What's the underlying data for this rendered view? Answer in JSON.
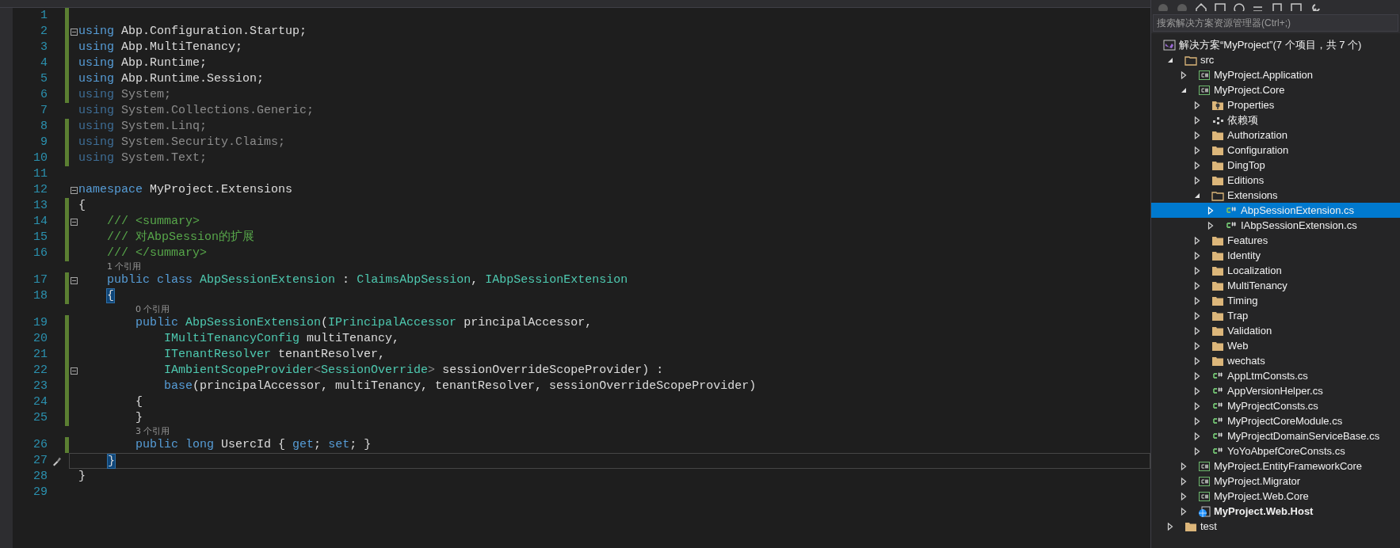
{
  "editor": {
    "lines": [
      {
        "number": "1",
        "modified": true,
        "fold": false,
        "current": false
      },
      {
        "number": "2",
        "modified": true,
        "fold": true,
        "current": false,
        "tokens": [
          {
            "kind": "kw",
            "text": "using"
          },
          {
            "kind": "text",
            "text": " Abp.Configuration.Startup;"
          }
        ]
      },
      {
        "number": "3",
        "modified": true,
        "fold": false,
        "current": false,
        "tokens": [
          {
            "kind": "kw",
            "text": "using"
          },
          {
            "kind": "text",
            "text": " Abp.MultiTenancy;"
          }
        ]
      },
      {
        "number": "4",
        "modified": true,
        "fold": false,
        "current": false,
        "tokens": [
          {
            "kind": "kw",
            "text": "using"
          },
          {
            "kind": "text",
            "text": " Abp.Runtime;"
          }
        ]
      },
      {
        "number": "5",
        "modified": true,
        "fold": false,
        "current": false,
        "tokens": [
          {
            "kind": "kw",
            "text": "using"
          },
          {
            "kind": "text",
            "text": " Abp.Runtime.Session;"
          }
        ]
      },
      {
        "number": "6",
        "modified": true,
        "fold": false,
        "current": false,
        "tokens": [
          {
            "kind": "kwdim",
            "text": "using"
          },
          {
            "kind": "textdim",
            "text": " System;"
          }
        ]
      },
      {
        "number": "7",
        "modified": false,
        "fold": false,
        "current": false,
        "tokens": [
          {
            "kind": "kwdim",
            "text": "using"
          },
          {
            "kind": "textdim",
            "text": " System.Collections.Generic;"
          }
        ]
      },
      {
        "number": "8",
        "modified": true,
        "fold": false,
        "current": false,
        "tokens": [
          {
            "kind": "kwdim",
            "text": "using"
          },
          {
            "kind": "textdim",
            "text": " System.Linq;"
          }
        ]
      },
      {
        "number": "9",
        "modified": true,
        "fold": false,
        "current": false,
        "tokens": [
          {
            "kind": "kwdim",
            "text": "using"
          },
          {
            "kind": "textdim",
            "text": " System.Security.Claims;"
          }
        ]
      },
      {
        "number": "10",
        "modified": true,
        "fold": false,
        "current": false,
        "tokens": [
          {
            "kind": "kwdim",
            "text": "using"
          },
          {
            "kind": "textdim",
            "text": " System.Text;"
          }
        ]
      },
      {
        "number": "11",
        "modified": false,
        "fold": false,
        "current": false
      },
      {
        "number": "12",
        "modified": false,
        "fold": true,
        "current": false,
        "tokens": [
          {
            "kind": "kw",
            "text": "namespace"
          },
          {
            "kind": "text",
            "text": " MyProject.Extensions"
          }
        ]
      },
      {
        "number": "13",
        "modified": true,
        "fold": false,
        "current": false,
        "tokens": [
          {
            "kind": "text",
            "text": "{"
          }
        ]
      },
      {
        "number": "14",
        "modified": true,
        "fold": true,
        "current": false,
        "tokens": [
          {
            "kind": "comment",
            "text": "    /// <summary>"
          }
        ]
      },
      {
        "number": "15",
        "modified": true,
        "fold": false,
        "current": false,
        "tokens": [
          {
            "kind": "comment",
            "text": "    /// 对AbpSession的扩展"
          }
        ]
      },
      {
        "number": "16",
        "modified": true,
        "fold": false,
        "current": false,
        "tokens": [
          {
            "kind": "comment",
            "text": "    /// </summary>"
          }
        ]
      },
      {
        "number": "17",
        "modified": true,
        "fold": true,
        "current": false,
        "codelens": "1 个引用",
        "tokens": [
          {
            "kind": "kw",
            "text": "    public class"
          },
          {
            "kind": "type",
            "text": " AbpSessionExtension"
          },
          {
            "kind": "text",
            "text": " :"
          },
          {
            "kind": "type",
            "text": " ClaimsAbpSession"
          },
          {
            "kind": "text",
            "text": ","
          },
          {
            "kind": "type",
            "text": " IAbpSessionExtension"
          }
        ]
      },
      {
        "number": "18",
        "modified": true,
        "fold": false,
        "current": false,
        "tokens": [
          {
            "kind": "brace",
            "text": "    {"
          }
        ]
      },
      {
        "number": "19",
        "modified": true,
        "fold": false,
        "current": false,
        "codelens": "0 个引用",
        "tokens": [
          {
            "kind": "kw",
            "text": "        public"
          },
          {
            "kind": "type",
            "text": " AbpSessionExtension"
          },
          {
            "kind": "text",
            "text": "("
          },
          {
            "kind": "type",
            "text": "IPrincipalAccessor"
          },
          {
            "kind": "text",
            "text": " principalAccessor,"
          }
        ]
      },
      {
        "number": "20",
        "modified": true,
        "fold": false,
        "current": false,
        "tokens": [
          {
            "kind": "type",
            "text": "            IMultiTenancyConfig"
          },
          {
            "kind": "text",
            "text": " multiTenancy,"
          }
        ]
      },
      {
        "number": "21",
        "modified": true,
        "fold": false,
        "current": false,
        "tokens": [
          {
            "kind": "type",
            "text": "            ITenantResolver"
          },
          {
            "kind": "text",
            "text": " tenantResolver,"
          }
        ]
      },
      {
        "number": "22",
        "modified": true,
        "fold": true,
        "current": false,
        "tokens": [
          {
            "kind": "type",
            "text": "            IAmbientScopeProvider"
          },
          {
            "kind": "textdim",
            "text": "<"
          },
          {
            "kind": "type",
            "text": "SessionOverride"
          },
          {
            "kind": "textdim",
            "text": ">"
          },
          {
            "kind": "text",
            "text": " sessionOverrideScopeProvider) :"
          }
        ]
      },
      {
        "number": "23",
        "modified": true,
        "fold": false,
        "current": false,
        "tokens": [
          {
            "kind": "kw",
            "text": "            base"
          },
          {
            "kind": "text",
            "text": "(principalAccessor, multiTenancy, tenantResolver, sessionOverrideScopeProvider)"
          }
        ]
      },
      {
        "number": "24",
        "modified": true,
        "fold": false,
        "current": false,
        "tokens": [
          {
            "kind": "text",
            "text": "        {"
          }
        ]
      },
      {
        "number": "25",
        "modified": true,
        "fold": false,
        "current": false,
        "tokens": [
          {
            "kind": "text",
            "text": "        }"
          }
        ]
      },
      {
        "number": "26",
        "modified": true,
        "fold": false,
        "current": false,
        "codelens": "3 个引用",
        "tokens": [
          {
            "kind": "kw",
            "text": "        public long"
          },
          {
            "kind": "text",
            "text": " UsercId {"
          },
          {
            "kind": "kw",
            "text": " get"
          },
          {
            "kind": "text",
            "text": ";"
          },
          {
            "kind": "kw",
            "text": " set"
          },
          {
            "kind": "text",
            "text": "; }"
          }
        ]
      },
      {
        "number": "27",
        "modified": false,
        "fold": false,
        "current": true,
        "tokens": [
          {
            "kind": "brace",
            "text": "    }"
          }
        ]
      },
      {
        "number": "28",
        "modified": false,
        "fold": false,
        "current": false,
        "tokens": [
          {
            "kind": "text",
            "text": "}"
          }
        ]
      },
      {
        "number": "29",
        "modified": false,
        "fold": false,
        "current": false
      }
    ]
  },
  "solution_explorer": {
    "search": {
      "placeholder": "搜索解决方案资源管理器(Ctrl+;)"
    },
    "tree": [
      {
        "kind": "solution",
        "label": "解决方案“MyProject”(7 个项目，共 7 个)",
        "selected": false,
        "children": [
          {
            "kind": "folder",
            "label": "src",
            "expanded": true,
            "selected": false,
            "children": [
              {
                "kind": "project",
                "label": "MyProject.Application",
                "expanded": false,
                "selected": false
              },
              {
                "kind": "project",
                "label": "MyProject.Core",
                "expanded": true,
                "selected": false,
                "children": [
                  {
                    "kind": "properties",
                    "label": "Properties",
                    "expanded": false,
                    "selected": false
                  },
                  {
                    "kind": "dependencies",
                    "label": "依赖项",
                    "expanded": false,
                    "selected": false
                  },
                  {
                    "kind": "folder",
                    "label": "Authorization",
                    "expanded": false,
                    "selected": false
                  },
                  {
                    "kind": "folder",
                    "label": "Configuration",
                    "expanded": false,
                    "selected": false
                  },
                  {
                    "kind": "folder",
                    "label": "DingTop",
                    "expanded": false,
                    "selected": false
                  },
                  {
                    "kind": "folder",
                    "label": "Editions",
                    "expanded": false,
                    "selected": false
                  },
                  {
                    "kind": "folder",
                    "label": "Extensions",
                    "expanded": true,
                    "selected": false,
                    "children": [
                      {
                        "kind": "file",
                        "label": "AbpSessionExtension.cs",
                        "expanded": false,
                        "selected": true
                      },
                      {
                        "kind": "file",
                        "label": "IAbpSessionExtension.cs",
                        "expanded": false,
                        "selected": false
                      }
                    ]
                  },
                  {
                    "kind": "folder",
                    "label": "Features",
                    "expanded": false,
                    "selected": false
                  },
                  {
                    "kind": "folder",
                    "label": "Identity",
                    "expanded": false,
                    "selected": false
                  },
                  {
                    "kind": "folder",
                    "label": "Localization",
                    "expanded": false,
                    "selected": false
                  },
                  {
                    "kind": "folder",
                    "label": "MultiTenancy",
                    "expanded": false,
                    "selected": false
                  },
                  {
                    "kind": "folder",
                    "label": "Timing",
                    "expanded": false,
                    "selected": false
                  },
                  {
                    "kind": "folder",
                    "label": "Trap",
                    "expanded": false,
                    "selected": false
                  },
                  {
                    "kind": "folder",
                    "label": "Validation",
                    "expanded": false,
                    "selected": false
                  },
                  {
                    "kind": "folder",
                    "label": "Web",
                    "expanded": false,
                    "selected": false
                  },
                  {
                    "kind": "folder",
                    "label": "wechats",
                    "expanded": false,
                    "selected": false
                  },
                  {
                    "kind": "file",
                    "label": "AppLtmConsts.cs",
                    "expanded": false,
                    "selected": false
                  },
                  {
                    "kind": "file",
                    "label": "AppVersionHelper.cs",
                    "expanded": false,
                    "selected": false
                  },
                  {
                    "kind": "file",
                    "label": "MyProjectConsts.cs",
                    "expanded": false,
                    "selected": false
                  },
                  {
                    "kind": "file",
                    "label": "MyProjectCoreModule.cs",
                    "expanded": false,
                    "selected": false
                  },
                  {
                    "kind": "file",
                    "label": "MyProjectDomainServiceBase.cs",
                    "expanded": false,
                    "selected": false
                  },
                  {
                    "kind": "file",
                    "label": "YoYoAbpefCoreConsts.cs",
                    "expanded": false,
                    "selected": false
                  }
                ]
              },
              {
                "kind": "project",
                "label": "MyProject.EntityFrameworkCore",
                "expanded": false,
                "selected": false
              },
              {
                "kind": "project",
                "label": "MyProject.Migrator",
                "expanded": false,
                "selected": false
              },
              {
                "kind": "project",
                "label": "MyProject.Web.Core",
                "expanded": false,
                "selected": false
              },
              {
                "kind": "web_project",
                "label": "MyProject.Web.Host",
                "expanded": false,
                "selected": false
              }
            ]
          },
          {
            "kind": "folder",
            "label": "test",
            "expanded": false,
            "selected": false
          }
        ]
      }
    ]
  }
}
